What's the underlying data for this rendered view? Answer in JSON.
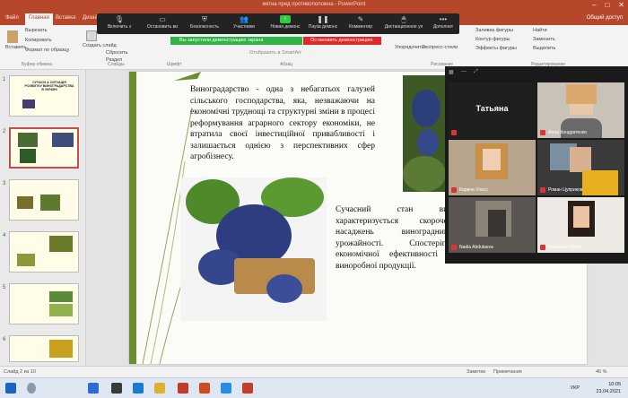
{
  "window": {
    "title": "кмтна пред противоположна - PowerPoint"
  },
  "ribbon": {
    "tabs": [
      "Файл",
      "Главная",
      "Вставка",
      "Дизайн"
    ],
    "active_tab": "Главная",
    "user": "Общий доступ",
    "clipboard": {
      "paste": "Вставить",
      "cut": "Вырезать",
      "copy": "Копировать",
      "format": "Формат по образцу",
      "group": "Буфер обмена"
    },
    "slides": {
      "new": "Создать слайд",
      "reuse": "Использовать",
      "reset": "Сбросить",
      "section": "Раздел",
      "group": "Слайды"
    },
    "font_group": "Шрифт",
    "paragraph_group": "Абзац",
    "right_items": [
      "Заливка фигуры",
      "Контур фигуры",
      "Эффекты фигуры",
      "Найти",
      "Заменить",
      "Выделить"
    ],
    "right_groups": [
      "Рисование",
      "Редактирование"
    ],
    "arrange": "Упорядочить",
    "quick_styles": "Экспресс-стили"
  },
  "zoom_toolbar": {
    "buttons": [
      {
        "label": "Включить з",
        "icon": "microphone-icon"
      },
      {
        "label": "Остановить ви",
        "icon": "camera-icon"
      },
      {
        "label": "Безопасность",
        "icon": "shield-icon"
      },
      {
        "label": "Участники",
        "icon": "participants-icon",
        "count": "24"
      },
      {
        "label": "Новая демонс",
        "icon": "share-icon"
      },
      {
        "label": "Пауза демонс",
        "icon": "pause-icon"
      },
      {
        "label": "Комментир",
        "icon": "pencil-icon"
      },
      {
        "label": "Дистанционное уп",
        "icon": "mouse-icon"
      },
      {
        "label": "Дополнит",
        "icon": "more-icon"
      }
    ],
    "share_banner": "Вы запустили демонстрацию экрана",
    "stop_share": "Остановить демонстрацию",
    "display_in_zoom": "Отобразить в SmartArt"
  },
  "thumbnails": [
    {
      "num": "1",
      "title": "СУЧАСН А СИТУАЦІЯ РОЗВИТКУ ВИНОГРАДАРСТВА В УКРАЇНІ"
    },
    {
      "num": "2",
      "title": ""
    },
    {
      "num": "3",
      "title": ""
    },
    {
      "num": "4",
      "title": ""
    },
    {
      "num": "5",
      "title": ""
    },
    {
      "num": "6",
      "title": ""
    }
  ],
  "slide": {
    "paragraph1": "Виноградарство - одна з небагатьох галузей сільського господарства, яка, незважаючи на економічні труднощі та структурні зміни в процесі реформування аграрного сектору економіки, не втратила своєї інвестиційної привабливості і залишається однією з перспективних сфер агробізнесу.",
    "paragraph2": "Сучасний стан вино характеризується скороченн насаджень виноградників, урожайності. Спостерігаєт економічної ефективності ви виноробної продукції."
  },
  "gallery": {
    "tiles": [
      {
        "name": "Татьяна",
        "type": "name-only"
      },
      {
        "name": "Алла Кондратенко"
      },
      {
        "name": "Карина Уласу"
      },
      {
        "name": "Роман Цуприков"
      },
      {
        "name": "Nadia Abdulaeva"
      },
      {
        "name": "Anastasia Bilitski"
      }
    ]
  },
  "statusbar": {
    "slide_info": "Слайд 2 из 10",
    "notes": "Заметки",
    "comments": "Примечания",
    "zoom": "46 %"
  },
  "taskbar": {
    "time": "10:05",
    "date": "23.04.2021",
    "lang": "УКР"
  },
  "colors": {
    "ppt_accent": "#b7472a",
    "zoom_share_green": "#2fb344",
    "zoom_stop_red": "#e02828",
    "slide_bar_green": "#6b8f2e"
  }
}
